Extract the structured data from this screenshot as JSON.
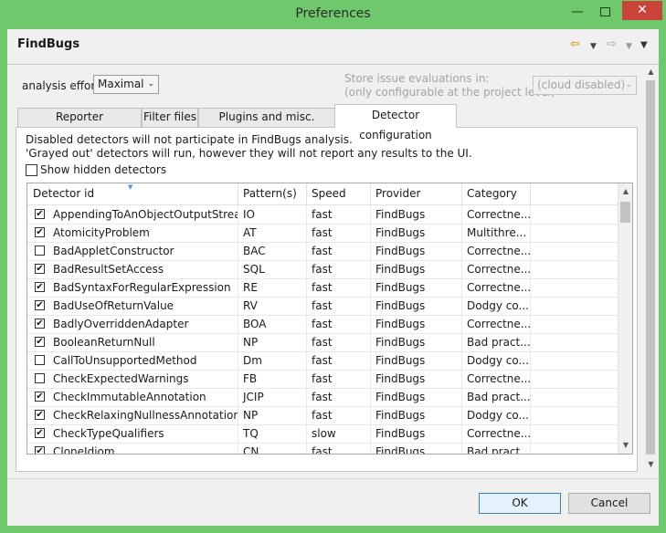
{
  "window": {
    "title": "Preferences"
  },
  "header": {
    "title": "FindBugs"
  },
  "settings": {
    "analysis_effort_label": "analysis effort",
    "analysis_effort_value": "Maximal",
    "store_label_line1": "Store issue evaluations in:",
    "store_label_line2": "(only configurable at the project level)",
    "store_value": "(cloud disabled)"
  },
  "tabs": [
    {
      "label": "Reporter Configuration"
    },
    {
      "label": "Filter files"
    },
    {
      "label": "Plugins and misc. Settings"
    },
    {
      "label": "Detector configuration"
    }
  ],
  "panel": {
    "info_line1": "Disabled detectors will not participate in FindBugs analysis.",
    "info_line2": "'Grayed out' detectors will run, however they will not report any results to the UI.",
    "show_hidden_label": "Show hidden detectors",
    "show_hidden_checked": false
  },
  "table": {
    "columns": [
      "Detector id",
      "Pattern(s)",
      "Speed",
      "Provider",
      "Category"
    ],
    "rows": [
      {
        "checked": true,
        "id": "AppendingToAnObjectOutputStream",
        "pattern": "IO",
        "speed": "fast",
        "provider": "FindBugs",
        "category": "Correctne..."
      },
      {
        "checked": true,
        "id": "AtomicityProblem",
        "pattern": "AT",
        "speed": "fast",
        "provider": "FindBugs",
        "category": "Multithre..."
      },
      {
        "checked": false,
        "id": "BadAppletConstructor",
        "pattern": "BAC",
        "speed": "fast",
        "provider": "FindBugs",
        "category": "Correctne..."
      },
      {
        "checked": true,
        "id": "BadResultSetAccess",
        "pattern": "SQL",
        "speed": "fast",
        "provider": "FindBugs",
        "category": "Correctne..."
      },
      {
        "checked": true,
        "id": "BadSyntaxForRegularExpression",
        "pattern": "RE",
        "speed": "fast",
        "provider": "FindBugs",
        "category": "Correctne..."
      },
      {
        "checked": true,
        "id": "BadUseOfReturnValue",
        "pattern": "RV",
        "speed": "fast",
        "provider": "FindBugs",
        "category": "Dodgy co..."
      },
      {
        "checked": true,
        "id": "BadlyOverriddenAdapter",
        "pattern": "BOA",
        "speed": "fast",
        "provider": "FindBugs",
        "category": "Correctne..."
      },
      {
        "checked": true,
        "id": "BooleanReturnNull",
        "pattern": "NP",
        "speed": "fast",
        "provider": "FindBugs",
        "category": "Bad pract..."
      },
      {
        "checked": false,
        "id": "CallToUnsupportedMethod",
        "pattern": "Dm",
        "speed": "fast",
        "provider": "FindBugs",
        "category": "Dodgy co..."
      },
      {
        "checked": false,
        "id": "CheckExpectedWarnings",
        "pattern": "FB",
        "speed": "fast",
        "provider": "FindBugs",
        "category": "Correctne..."
      },
      {
        "checked": true,
        "id": "CheckImmutableAnnotation",
        "pattern": "JCIP",
        "speed": "fast",
        "provider": "FindBugs",
        "category": "Bad pract..."
      },
      {
        "checked": true,
        "id": "CheckRelaxingNullnessAnnotation",
        "pattern": "NP",
        "speed": "fast",
        "provider": "FindBugs",
        "category": "Dodgy co..."
      },
      {
        "checked": true,
        "id": "CheckTypeQualifiers",
        "pattern": "TQ",
        "speed": "slow",
        "provider": "FindBugs",
        "category": "Correctne..."
      },
      {
        "checked": true,
        "id": "CloneIdiom",
        "pattern": "CN",
        "speed": "fast",
        "provider": "FindBugs",
        "category": "Bad pract..."
      }
    ]
  },
  "buttons": {
    "ok": "OK",
    "cancel": "Cancel"
  },
  "colors": {
    "window_frame": "#6fc86c",
    "close_button": "#c9433a",
    "ok_border": "#3c7fb1"
  }
}
